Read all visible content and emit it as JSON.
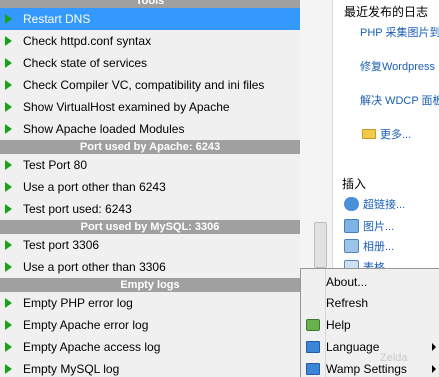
{
  "tools_menu": {
    "top_header": "Tools",
    "items_top": [
      "Restart DNS",
      "Check httpd.conf syntax",
      "Check state of services",
      "Check Compiler VC, compatibility and ini files",
      "Show VirtualHost examined by Apache",
      "Show Apache loaded Modules"
    ],
    "apache_port_header": "Port used by Apache: 6243",
    "apache_port_items": [
      "Test Port 80",
      "Use a port other than 6243",
      "Test port used: 6243"
    ],
    "mysql_port_header": "Port used by MySQL: 3306",
    "mysql_port_items": [
      "Test port 3306",
      "Use a port other than 3306"
    ],
    "logs_header": "Empty logs",
    "logs_items": [
      "Empty PHP error log",
      "Empty Apache error log",
      "Empty Apache access log",
      "Empty MySQL log"
    ],
    "selected_item": "Restart DNS"
  },
  "blog_panel": {
    "title": "最近发布的日志",
    "links": [
      "PHP 采集图片到",
      "修复Wordpress",
      "解决 WDCP 面板"
    ],
    "more": "更多...",
    "insert_title": "插入",
    "insert_items": [
      "超链接...",
      "图片...",
      "相册...",
      "表格..."
    ]
  },
  "context_menu": {
    "items": [
      "About...",
      "Refresh",
      "Help",
      "Language",
      "Wamp Settings"
    ]
  },
  "watermark": "Zelda",
  "colors": {
    "menu_bg": "#f0f0f0",
    "selected_bg": "#3399ff",
    "section_header_bg": "#a0a0a0",
    "arrow_green": "#17a317",
    "link_blue": "#1a5fb4"
  },
  "icons": {
    "menu_arrow": "play-arrow-icon",
    "submenu_arrow": "chevron-right-icon",
    "help": "help-icon",
    "folder": "folder-icon"
  }
}
